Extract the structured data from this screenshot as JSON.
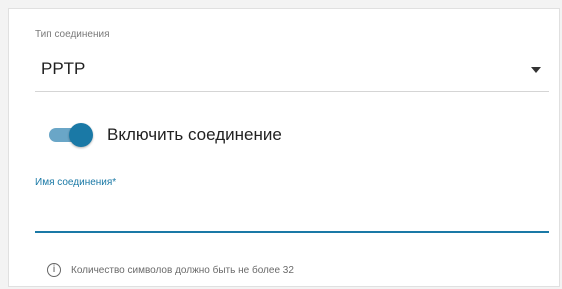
{
  "connection_type": {
    "label": "Тип соединения",
    "value": "PPTP"
  },
  "toggle": {
    "label": "Включить соединение",
    "enabled": true
  },
  "connection_name": {
    "label": "Имя соединения*",
    "value": ""
  },
  "hint": {
    "text": "Количество символов должно быть не более 32"
  },
  "colors": {
    "accent": "#1a79a6",
    "track": "#6aa6c7"
  },
  "icons": {
    "info": "info-icon",
    "dropdown": "chevron-down-icon"
  }
}
